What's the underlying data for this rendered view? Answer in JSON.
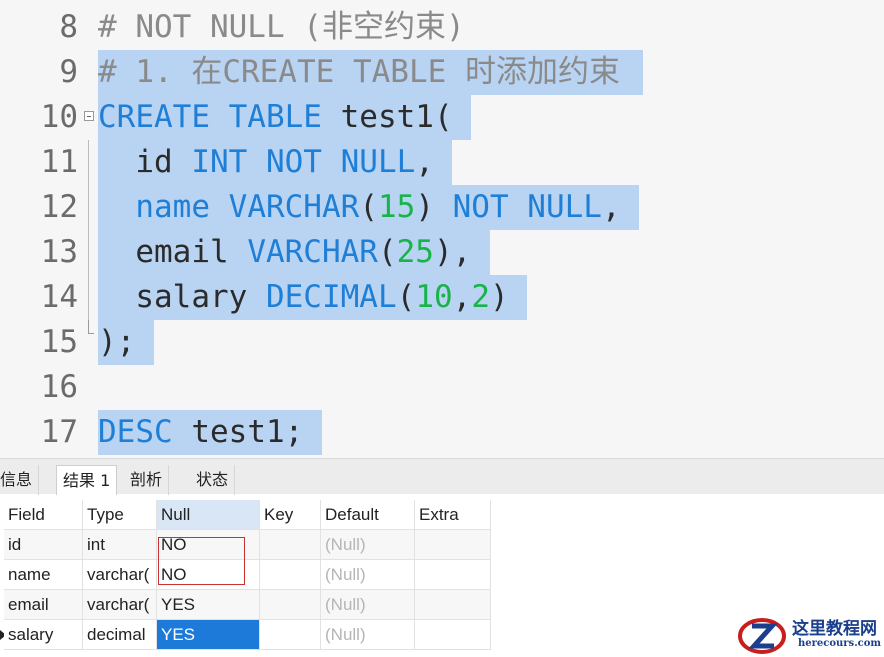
{
  "editor": {
    "lines": [
      {
        "num": "8",
        "tokens": [
          {
            "t": "# NOT NULL (非空约束)",
            "c": "cm"
          }
        ]
      },
      {
        "num": "9",
        "tokens": [
          {
            "t": "# 1. 在CREATE TABLE 时添加约束",
            "c": "cm"
          }
        ]
      },
      {
        "num": "10",
        "tokens": [
          {
            "t": "CREATE TABLE ",
            "c": "kw"
          },
          {
            "t": "test1(",
            "c": ""
          }
        ]
      },
      {
        "num": "11",
        "tokens": [
          {
            "t": "  id ",
            "c": ""
          },
          {
            "t": "INT NOT NULL",
            "c": "kw"
          },
          {
            "t": ",",
            "c": ""
          }
        ]
      },
      {
        "num": "12",
        "tokens": [
          {
            "t": "  name ",
            "c": "kw"
          },
          {
            "t": "VARCHAR",
            "c": "kw"
          },
          {
            "t": "(",
            "c": ""
          },
          {
            "t": "15",
            "c": "num"
          },
          {
            "t": ") ",
            "c": ""
          },
          {
            "t": "NOT NULL",
            "c": "kw"
          },
          {
            "t": ",",
            "c": ""
          }
        ]
      },
      {
        "num": "13",
        "tokens": [
          {
            "t": "  email ",
            "c": ""
          },
          {
            "t": "VARCHAR",
            "c": "kw"
          },
          {
            "t": "(",
            "c": ""
          },
          {
            "t": "25",
            "c": "num"
          },
          {
            "t": "),",
            "c": ""
          }
        ]
      },
      {
        "num": "14",
        "tokens": [
          {
            "t": "  salary ",
            "c": ""
          },
          {
            "t": "DECIMAL",
            "c": "kw"
          },
          {
            "t": "(",
            "c": ""
          },
          {
            "t": "10",
            "c": "num"
          },
          {
            "t": ",",
            "c": ""
          },
          {
            "t": "2",
            "c": "num"
          },
          {
            "t": ")",
            "c": ""
          }
        ]
      },
      {
        "num": "15",
        "tokens": [
          {
            "t": ");",
            "c": ""
          }
        ]
      },
      {
        "num": "16",
        "tokens": []
      },
      {
        "num": "17",
        "tokens": [
          {
            "t": "DESC ",
            "c": "kw"
          },
          {
            "t": "test1;",
            "c": ""
          }
        ]
      }
    ]
  },
  "tabs": [
    "信息",
    "结果 1",
    "剖析",
    "状态"
  ],
  "results": {
    "columns": [
      "Field",
      "Type",
      "Null",
      "Key",
      "Default",
      "Extra"
    ],
    "rows": [
      [
        "id",
        "int",
        "NO",
        "",
        "(Null)",
        ""
      ],
      [
        "name",
        "varchar(",
        "NO",
        "",
        "(Null)",
        ""
      ],
      [
        "email",
        "varchar(",
        "YES",
        "",
        "(Null)",
        ""
      ],
      [
        "salary",
        "decimal",
        "YES",
        "",
        "(Null)",
        ""
      ]
    ]
  },
  "watermark": {
    "title": "这里教程网",
    "url": "herecours.com"
  }
}
